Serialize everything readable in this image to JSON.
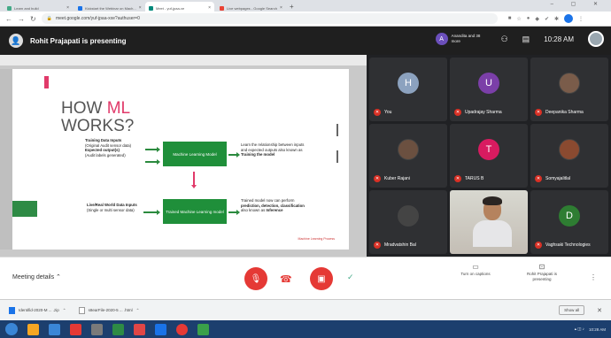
{
  "browser": {
    "tabs": [
      {
        "label": "Learn and build",
        "active": false
      },
      {
        "label": "Kickstart the Webinar on Mach...",
        "active": false
      },
      {
        "label": "Meet - yuf-jpaa-xe",
        "active": true
      },
      {
        "label": "Live webpages - Google Search",
        "active": false
      }
    ],
    "new_tab": "+",
    "url": "meet.google.com/yuf-jpaa-xxe?authuser=0",
    "window_controls": "– ▢ ✕"
  },
  "meet": {
    "presenting_title": "Rohit Prajapati is presenting",
    "owner_initial": "A",
    "owner_text": "Anandita and 38 more",
    "time": "10:28 AM",
    "participants": [
      {
        "name": "You",
        "initial": "H",
        "color": "#8ca2bf",
        "type": "initial"
      },
      {
        "name": "Upadrajay Sharma",
        "initial": "U",
        "color": "#7b3fa8",
        "type": "initial"
      },
      {
        "name": "Deepanika Sharma",
        "initial": "",
        "color": "#7a5c4a",
        "type": "photo"
      },
      {
        "name": "Kuber Rajani",
        "initial": "",
        "color": "#6b5040",
        "type": "photo"
      },
      {
        "name": "TARUS B",
        "initial": "T",
        "color": "#d81b60",
        "type": "initial"
      },
      {
        "name": "Somyajalitlal",
        "initial": "",
        "color": "#8a4a30",
        "type": "photo"
      },
      {
        "name": "Mradvatshin Bal",
        "initial": "",
        "color": "#444",
        "type": "photo"
      },
      {
        "name": "",
        "initial": "",
        "color": "",
        "type": "video"
      },
      {
        "name": "Vaghsaki Technologies",
        "initial": "D",
        "color": "#2e7d32",
        "type": "initial"
      }
    ]
  },
  "slide": {
    "title_pre": "HOW ",
    "title_ml": "ML",
    "title_post": "WORKS?",
    "training_data_label": "Training Data Inputs",
    "training_data_desc": "(Original Audit sensor data)",
    "expected_output_label": "Expected output(s)",
    "expected_output_desc": "(Audit labels generated)",
    "ml_model_label": "Machine Learning Model",
    "learn_text": "Learn the relationship between inputs and expected outputs also known as",
    "learn_bold": "Training the model",
    "live_data_label": "Live/Real World Data Inputs",
    "live_data_desc": "(Single or multi sensor data)",
    "trained_model_label": "Trained Machine Learning model",
    "trained_text": "Trained model now can perform",
    "trained_bold": "prediction, detection, classification",
    "trained_tail": "also known as",
    "inference_bold": "Inference",
    "footer": "Machine Learning Process"
  },
  "controls": {
    "meeting_details": "Meeting details",
    "captions_label": "Turn on captions",
    "presenting_label": "Rohit Prajapati is presenting"
  },
  "downloads": {
    "items": [
      {
        "label": "Identifid-2020-M ... .zip"
      },
      {
        "label": "s8earFile-2020-5 ... .html"
      }
    ],
    "show_all": "Show all"
  },
  "taskbar": {
    "apps": [
      "#f5a623",
      "#3a86d6",
      "#e53935",
      "#7a7a7a",
      "#2e8b45",
      "#e04646",
      "#1a73e8",
      "#e53935",
      "#3aa04a"
    ],
    "tray": "10:28 AM"
  }
}
